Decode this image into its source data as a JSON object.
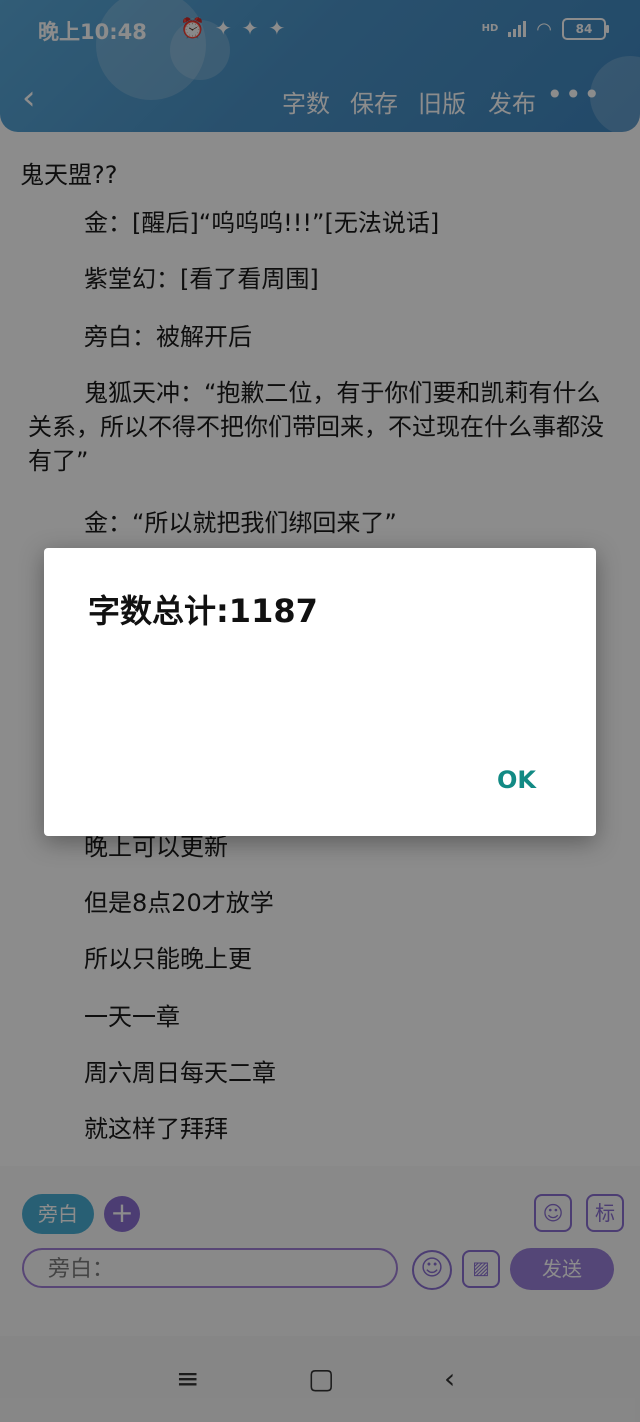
{
  "status_bar": {
    "time": "晚上10:48",
    "network": "HD",
    "battery": "84"
  },
  "toolbar": {
    "word_count": "字数",
    "save": "保存",
    "old_version": "旧版",
    "publish": "发布",
    "more": "•••"
  },
  "content": {
    "lines": [
      "鬼天盟??",
      "金：[醒后]“呜呜呜!!!”[无法说话]",
      "紫堂幻：[看了看周围]",
      "旁白：被解开后",
      "鬼狐天冲：“抱歉二位，有于你们要和凯莉有什么关系，所以不得不把你们带回来，不过现在什么事都没有了”",
      "金：“所以就把我们绑回来了”",
      "晚上可以更新",
      "但是8点20才放学",
      "所以只能晚上更",
      "一天一章",
      "周六周日每天二章",
      "就这样了拜拜"
    ]
  },
  "composer": {
    "role_chip": "旁白",
    "add": "+",
    "tag": "标",
    "input_placeholder": "旁白：",
    "send": "发送"
  },
  "dialog": {
    "title": "字数总计:1187",
    "ok": "OK"
  },
  "colors": {
    "header": "#4b93c7",
    "accent": "#8a6fd1",
    "ok": "#128a84"
  }
}
